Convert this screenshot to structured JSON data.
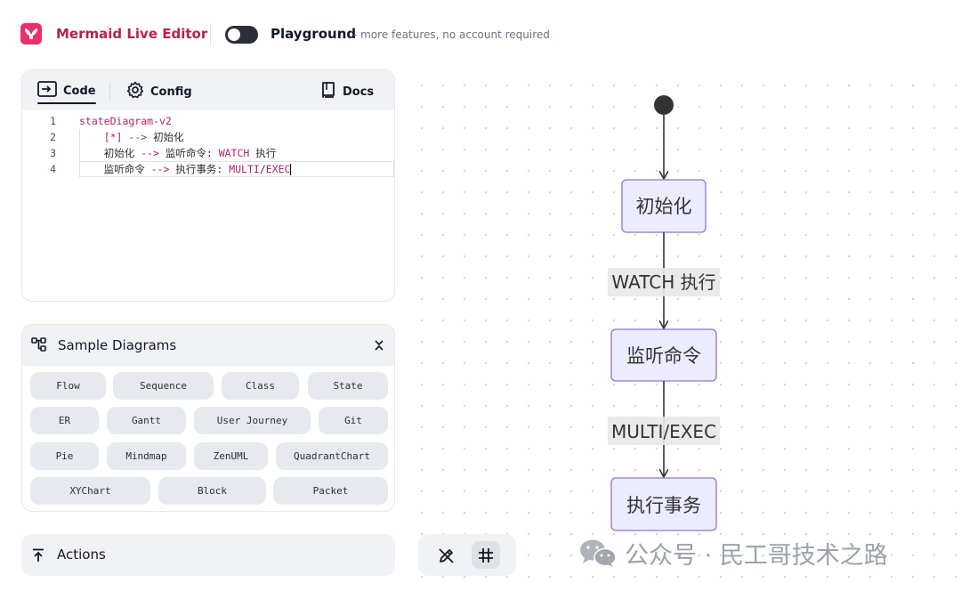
{
  "header": {
    "app_title": "Mermaid Live Editor",
    "playground_label": "Playground",
    "playground_desc": "- more features, no account required"
  },
  "editor": {
    "tabs": {
      "code": "Code",
      "config": "Config",
      "docs": "Docs"
    },
    "lines": [
      {
        "num": "1",
        "parts": [
          {
            "t": "stateDiagram-v2",
            "c": "kw"
          }
        ]
      },
      {
        "num": "2",
        "parts": [
          {
            "t": "    ",
            "c": "plain"
          },
          {
            "t": "[*]",
            "c": "kw"
          },
          {
            "t": " --> ",
            "c": "arrow"
          },
          {
            "t": "初始化",
            "c": "plain"
          }
        ]
      },
      {
        "num": "3",
        "parts": [
          {
            "t": "    初始化 ",
            "c": "plain"
          },
          {
            "t": "-->",
            "c": "arrow"
          },
          {
            "t": " 监听命令: ",
            "c": "plain"
          },
          {
            "t": "WATCH",
            "c": "kw"
          },
          {
            "t": " 执行",
            "c": "plain"
          }
        ]
      },
      {
        "num": "4",
        "parts": [
          {
            "t": "    监听命令 ",
            "c": "plain"
          },
          {
            "t": "-->",
            "c": "arrow"
          },
          {
            "t": " 执行事务: ",
            "c": "plain"
          },
          {
            "t": "MULTI",
            "c": "kw"
          },
          {
            "t": "/",
            "c": "plain"
          },
          {
            "t": "EXEC",
            "c": "kw"
          }
        ]
      }
    ]
  },
  "samples": {
    "title": "Sample Diagrams",
    "rows": [
      [
        "Flow",
        "Sequence",
        "Class",
        "State"
      ],
      [
        "ER",
        "Gantt",
        "User Journey",
        "Git"
      ],
      [
        "Pie",
        "Mindmap",
        "ZenUML",
        "QuadrantChart"
      ],
      [
        "XYChart",
        "Block",
        "Packet"
      ]
    ]
  },
  "actions": {
    "label": "Actions"
  },
  "diagram": {
    "states": [
      "初始化",
      "监听命令",
      "执行事务"
    ],
    "transitions": [
      "WATCH 执行",
      "MULTI/EXEC"
    ]
  },
  "watermark": {
    "text": "公众号 · 民工哥技术之路"
  },
  "colors": {
    "brand": "#ec2f6c",
    "node_fill": "#ECECFF",
    "node_stroke": "#9370DB"
  }
}
